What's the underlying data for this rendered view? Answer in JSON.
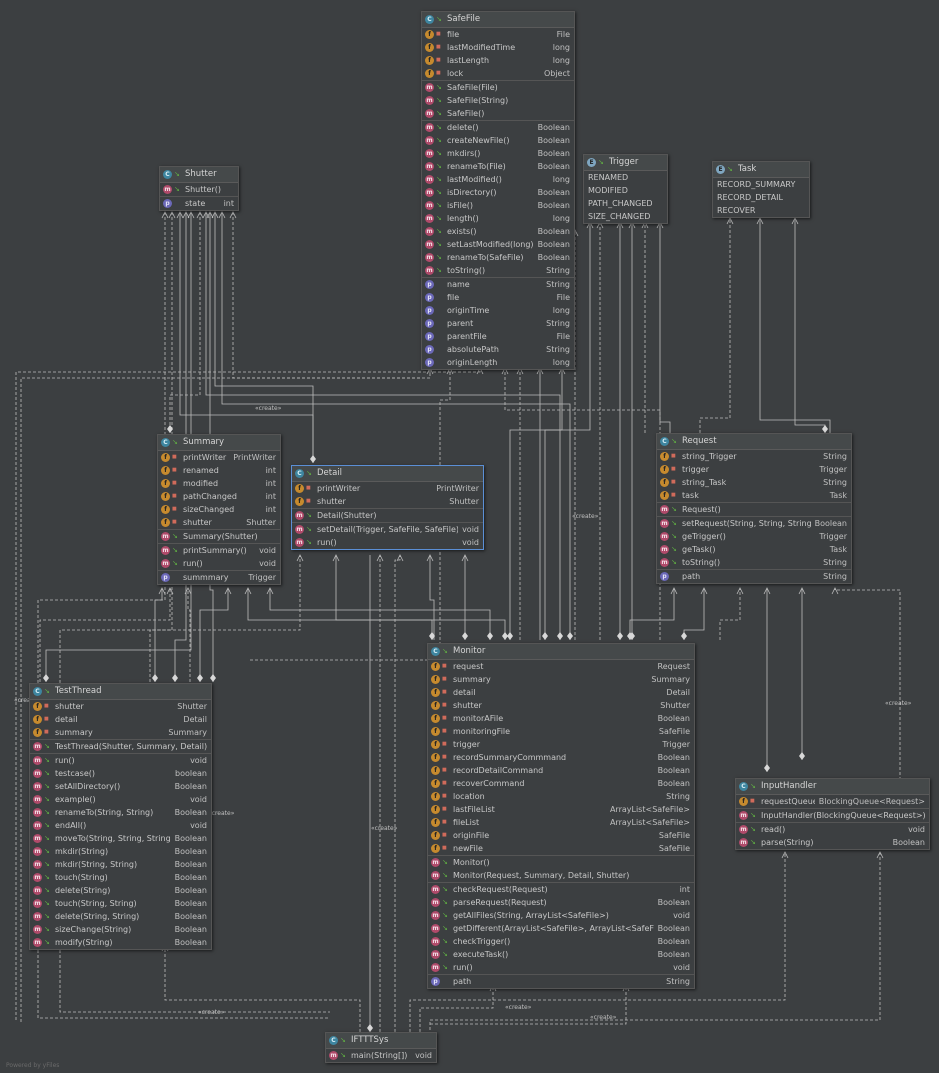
{
  "credit": "Powered by yFiles",
  "create_label": "«create»",
  "classes": {
    "safefile": {
      "name": "SafeFile",
      "fields": [
        {
          "name": "file",
          "type": "File",
          "icon": "f",
          "vis": "pri"
        },
        {
          "name": "lastModifiedTime",
          "type": "long",
          "icon": "f",
          "vis": "pri"
        },
        {
          "name": "lastLength",
          "type": "long",
          "icon": "f",
          "vis": "pri"
        },
        {
          "name": "lock",
          "type": "Object",
          "icon": "f",
          "vis": "pri"
        }
      ],
      "ctors": [
        {
          "name": "SafeFile(File)",
          "type": "",
          "icon": "m",
          "vis": "pub"
        },
        {
          "name": "SafeFile(String)",
          "type": "",
          "icon": "m",
          "vis": "pub"
        },
        {
          "name": "SafeFile()",
          "type": "",
          "icon": "m",
          "vis": "pub"
        }
      ],
      "methods": [
        {
          "name": "delete()",
          "type": "Boolean",
          "icon": "m",
          "vis": "pub"
        },
        {
          "name": "createNewFile()",
          "type": "Boolean",
          "icon": "m",
          "vis": "pub"
        },
        {
          "name": "mkdirs()",
          "type": "Boolean",
          "icon": "m",
          "vis": "pub"
        },
        {
          "name": "renameTo(File)",
          "type": "Boolean",
          "icon": "m",
          "vis": "pub"
        },
        {
          "name": "lastModified()",
          "type": "long",
          "icon": "m",
          "vis": "pub"
        },
        {
          "name": "isDirectory()",
          "type": "Boolean",
          "icon": "m",
          "vis": "pub"
        },
        {
          "name": "isFile()",
          "type": "Boolean",
          "icon": "m",
          "vis": "pub"
        },
        {
          "name": "length()",
          "type": "long",
          "icon": "m",
          "vis": "pub"
        },
        {
          "name": "exists()",
          "type": "Boolean",
          "icon": "m",
          "vis": "pub"
        },
        {
          "name": "setLastModified(long)",
          "type": "Boolean",
          "icon": "m",
          "vis": "pub"
        },
        {
          "name": "renameTo(SafeFile)",
          "type": "Boolean",
          "icon": "m",
          "vis": "pub"
        },
        {
          "name": "toString()",
          "type": "String",
          "icon": "m",
          "vis": "pub"
        }
      ],
      "props": [
        {
          "name": "name",
          "type": "String",
          "icon": "p",
          "vis": ""
        },
        {
          "name": "file",
          "type": "File",
          "icon": "p",
          "vis": ""
        },
        {
          "name": "originTime",
          "type": "long",
          "icon": "p",
          "vis": ""
        },
        {
          "name": "parent",
          "type": "String",
          "icon": "p",
          "vis": ""
        },
        {
          "name": "parentFile",
          "type": "File",
          "icon": "p",
          "vis": ""
        },
        {
          "name": "absolutePath",
          "type": "String",
          "icon": "p",
          "vis": ""
        },
        {
          "name": "originLength",
          "type": "long",
          "icon": "p",
          "vis": ""
        }
      ]
    },
    "shutter": {
      "name": "Shutter",
      "ctors": [
        {
          "name": "Shutter()",
          "type": "",
          "icon": "m",
          "vis": "pub"
        }
      ],
      "props": [
        {
          "name": "state",
          "type": "int",
          "icon": "p",
          "vis": ""
        }
      ]
    },
    "trigger": {
      "name": "Trigger",
      "values": [
        "RENAMED",
        "MODIFIED",
        "PATH_CHANGED",
        "SIZE_CHANGED"
      ]
    },
    "task": {
      "name": "Task",
      "values": [
        "RECORD_SUMMARY",
        "RECORD_DETAIL",
        "RECOVER"
      ]
    },
    "summary": {
      "name": "Summary",
      "fields": [
        {
          "name": "printWriter",
          "type": "PrintWriter",
          "icon": "f",
          "vis": "pri"
        },
        {
          "name": "renamed",
          "type": "int",
          "icon": "f",
          "vis": "pri"
        },
        {
          "name": "modified",
          "type": "int",
          "icon": "f",
          "vis": "pri"
        },
        {
          "name": "pathChanged",
          "type": "int",
          "icon": "f",
          "vis": "pri"
        },
        {
          "name": "sizeChanged",
          "type": "int",
          "icon": "f",
          "vis": "pri"
        },
        {
          "name": "shutter",
          "type": "Shutter",
          "icon": "f",
          "vis": "pri"
        }
      ],
      "ctors": [
        {
          "name": "Summary(Shutter)",
          "type": "",
          "icon": "m",
          "vis": "pub"
        }
      ],
      "methods": [
        {
          "name": "printSummary()",
          "type": "void",
          "icon": "m",
          "vis": "pub"
        },
        {
          "name": "run()",
          "type": "void",
          "icon": "m",
          "vis": "pub"
        }
      ],
      "props": [
        {
          "name": "summmary",
          "type": "Trigger",
          "icon": "p",
          "vis": ""
        }
      ]
    },
    "detail": {
      "name": "Detail",
      "fields": [
        {
          "name": "printWriter",
          "type": "PrintWriter",
          "icon": "f",
          "vis": "pri"
        },
        {
          "name": "shutter",
          "type": "Shutter",
          "icon": "f",
          "vis": "pri"
        }
      ],
      "ctors": [
        {
          "name": "Detail(Shutter)",
          "type": "",
          "icon": "m",
          "vis": "pub"
        }
      ],
      "methods": [
        {
          "name": "setDetail(Trigger, SafeFile, SafeFile)",
          "type": "void",
          "icon": "m",
          "vis": "pub"
        },
        {
          "name": "run()",
          "type": "void",
          "icon": "m",
          "vis": "pub"
        }
      ]
    },
    "request": {
      "name": "Request",
      "fields": [
        {
          "name": "string_Trigger",
          "type": "String",
          "icon": "f",
          "vis": "pri"
        },
        {
          "name": "trigger",
          "type": "Trigger",
          "icon": "f",
          "vis": "pri"
        },
        {
          "name": "string_Task",
          "type": "String",
          "icon": "f",
          "vis": "pri"
        },
        {
          "name": "task",
          "type": "Task",
          "icon": "f",
          "vis": "pri"
        }
      ],
      "ctors": [
        {
          "name": "Request()",
          "type": "",
          "icon": "m",
          "vis": "pub"
        }
      ],
      "methods": [
        {
          "name": "setRequest(String, String, String)",
          "type": "Boolean",
          "icon": "m",
          "vis": "pub"
        },
        {
          "name": "geTrigger()",
          "type": "Trigger",
          "icon": "m",
          "vis": "pub"
        },
        {
          "name": "geTask()",
          "type": "Task",
          "icon": "m",
          "vis": "pub"
        },
        {
          "name": "toString()",
          "type": "String",
          "icon": "m",
          "vis": "pub"
        }
      ],
      "props": [
        {
          "name": "path",
          "type": "String",
          "icon": "p",
          "vis": ""
        }
      ]
    },
    "testthread": {
      "name": "TestThread",
      "fields": [
        {
          "name": "shutter",
          "type": "Shutter",
          "icon": "f",
          "vis": "pri"
        },
        {
          "name": "detail",
          "type": "Detail",
          "icon": "f",
          "vis": "pri"
        },
        {
          "name": "summary",
          "type": "Summary",
          "icon": "f",
          "vis": "pri"
        }
      ],
      "ctors": [
        {
          "name": "TestThread(Shutter, Summary, Detail)",
          "type": "",
          "icon": "m",
          "vis": "pub"
        }
      ],
      "methods": [
        {
          "name": "run()",
          "type": "void",
          "icon": "m",
          "vis": "pub"
        },
        {
          "name": "testcase()",
          "type": "boolean",
          "icon": "m",
          "vis": "pub"
        },
        {
          "name": "setAllDirectory()",
          "type": "Boolean",
          "icon": "m",
          "vis": "pub"
        },
        {
          "name": "example()",
          "type": "void",
          "icon": "m",
          "vis": "pub"
        },
        {
          "name": "renameTo(String, String)",
          "type": "Boolean",
          "icon": "m",
          "vis": "pub"
        },
        {
          "name": "endAll()",
          "type": "void",
          "icon": "m",
          "vis": "pub"
        },
        {
          "name": "moveTo(String, String, String)",
          "type": "Boolean",
          "icon": "m",
          "vis": "pub"
        },
        {
          "name": "mkdir(String)",
          "type": "Boolean",
          "icon": "m",
          "vis": "pub"
        },
        {
          "name": "mkdir(String, String)",
          "type": "Boolean",
          "icon": "m",
          "vis": "pub"
        },
        {
          "name": "touch(String)",
          "type": "Boolean",
          "icon": "m",
          "vis": "pub"
        },
        {
          "name": "delete(String)",
          "type": "Boolean",
          "icon": "m",
          "vis": "pub"
        },
        {
          "name": "touch(String, String)",
          "type": "Boolean",
          "icon": "m",
          "vis": "pub"
        },
        {
          "name": "delete(String, String)",
          "type": "Boolean",
          "icon": "m",
          "vis": "pub"
        },
        {
          "name": "sizeChange(String)",
          "type": "Boolean",
          "icon": "m",
          "vis": "pub"
        },
        {
          "name": "modify(String)",
          "type": "Boolean",
          "icon": "m",
          "vis": "pub"
        }
      ]
    },
    "monitor": {
      "name": "Monitor",
      "fields": [
        {
          "name": "request",
          "type": "Request",
          "icon": "f",
          "vis": "pri"
        },
        {
          "name": "summary",
          "type": "Summary",
          "icon": "f",
          "vis": "pri"
        },
        {
          "name": "detail",
          "type": "Detail",
          "icon": "f",
          "vis": "pri"
        },
        {
          "name": "shutter",
          "type": "Shutter",
          "icon": "f",
          "vis": "pri"
        },
        {
          "name": "monitorAFile",
          "type": "Boolean",
          "icon": "f",
          "vis": "pri"
        },
        {
          "name": "monitoringFile",
          "type": "SafeFile",
          "icon": "f",
          "vis": "pri"
        },
        {
          "name": "trigger",
          "type": "Trigger",
          "icon": "f",
          "vis": "pri"
        },
        {
          "name": "recordSummaryCommmand",
          "type": "Boolean",
          "icon": "f",
          "vis": "pri"
        },
        {
          "name": "recordDetailCommand",
          "type": "Boolean",
          "icon": "f",
          "vis": "pri"
        },
        {
          "name": "recoverCommand",
          "type": "Boolean",
          "icon": "f",
          "vis": "pri"
        },
        {
          "name": "location",
          "type": "String",
          "icon": "f",
          "vis": "pri"
        },
        {
          "name": "lastFileList",
          "type": "ArrayList<SafeFile>",
          "icon": "f",
          "vis": "pri"
        },
        {
          "name": "fileList",
          "type": "ArrayList<SafeFile>",
          "icon": "f",
          "vis": "pri"
        },
        {
          "name": "originFile",
          "type": "SafeFile",
          "icon": "f",
          "vis": "pri"
        },
        {
          "name": "newFile",
          "type": "SafeFile",
          "icon": "f",
          "vis": "pri"
        }
      ],
      "ctors": [
        {
          "name": "Monitor()",
          "type": "",
          "icon": "m",
          "vis": "pub"
        },
        {
          "name": "Monitor(Request, Summary, Detail, Shutter)",
          "type": "",
          "icon": "m",
          "vis": "pub"
        }
      ],
      "methods": [
        {
          "name": "checkRequest(Request)",
          "type": "int",
          "icon": "m",
          "vis": "pub"
        },
        {
          "name": "parseRequest(Request)",
          "type": "Boolean",
          "icon": "m",
          "vis": "pub"
        },
        {
          "name": "getAllFiles(String, ArrayList<SafeFile>)",
          "type": "void",
          "icon": "m",
          "vis": "pub"
        },
        {
          "name": "getDifferent(ArrayList<SafeFile>, ArrayList<SafeFile>)",
          "type": "Boolean",
          "icon": "m",
          "vis": "pub"
        },
        {
          "name": "checkTrigger()",
          "type": "Boolean",
          "icon": "m",
          "vis": "pub"
        },
        {
          "name": "executeTask()",
          "type": "Boolean",
          "icon": "m",
          "vis": "pub"
        },
        {
          "name": "run()",
          "type": "void",
          "icon": "m",
          "vis": "pub"
        }
      ],
      "props": [
        {
          "name": "path",
          "type": "String",
          "icon": "p",
          "vis": ""
        }
      ]
    },
    "inputhandler": {
      "name": "InputHandler",
      "fields": [
        {
          "name": "requestQueue",
          "type": "BlockingQueue<Request>",
          "icon": "f",
          "vis": "pri"
        }
      ],
      "ctors": [
        {
          "name": "InputHandler(BlockingQueue<Request>)",
          "type": "",
          "icon": "m",
          "vis": "pub"
        }
      ],
      "methods": [
        {
          "name": "read()",
          "type": "void",
          "icon": "m",
          "vis": "pub"
        },
        {
          "name": "parse(String)",
          "type": "Boolean",
          "icon": "m",
          "vis": "pub"
        }
      ]
    },
    "iftttsys": {
      "name": "IFTTTSys",
      "methods": [
        {
          "name": "main(String[])",
          "type": "void",
          "icon": "m",
          "vis": "pub"
        }
      ]
    }
  }
}
